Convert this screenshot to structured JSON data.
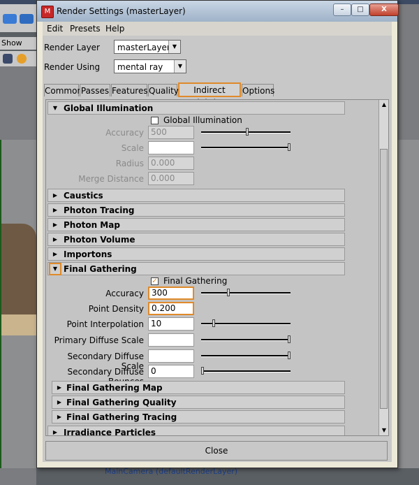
{
  "window": {
    "title": "Render Settings (masterLayer)",
    "controls": {
      "minimize": "–",
      "maximize": "□",
      "close": "X"
    }
  },
  "menu": [
    "Edit",
    "Presets",
    "Help"
  ],
  "render_layer": {
    "label": "Render Layer",
    "value": "masterLayer"
  },
  "render_using": {
    "label": "Render Using",
    "value": "mental ray"
  },
  "tabs": [
    "Common",
    "Passes",
    "Features",
    "Quality",
    "Indirect Lighting",
    "Options"
  ],
  "active_tab": "Indirect Lighting",
  "global_illumination": {
    "header": "Global Illumination",
    "checkbox_label": "Global Illumination",
    "checked": false,
    "fields": [
      {
        "label": "Accuracy",
        "value": "500",
        "slider": 0.52
      },
      {
        "label": "Scale",
        "value": "",
        "slider": 1.0
      },
      {
        "label": "Radius",
        "value": "0.000"
      },
      {
        "label": "Merge Distance",
        "value": "0.000"
      }
    ]
  },
  "collapsed_sections": [
    "Caustics",
    "Photon Tracing",
    "Photon Map",
    "Photon Volume",
    "Importons"
  ],
  "final_gathering": {
    "header": "Final Gathering",
    "checkbox_label": "Final Gathering",
    "checked": true,
    "fields": [
      {
        "label": "Accuracy",
        "value": "300",
        "slider": 0.3
      },
      {
        "label": "Point Density",
        "value": "0.200"
      },
      {
        "label": "Point Interpolation",
        "value": "10",
        "slider": 0.13
      },
      {
        "label": "Primary Diffuse Scale",
        "value": "",
        "slider": 1.0
      },
      {
        "label": "Secondary Diffuse Scale",
        "value": "",
        "slider": 1.0
      },
      {
        "label": "Secondary Diffuse Bounces",
        "value": "0",
        "slider": 0.0
      }
    ],
    "subsections": [
      "Final Gathering Map",
      "Final Gathering Quality",
      "Final Gathering Tracing"
    ]
  },
  "last_section": "Irradiance Particles",
  "close_label": "Close",
  "background": {
    "show_menu": "Show",
    "camera_label": "MainCamera (defaultRenderLayer)"
  },
  "colors": {
    "highlight": "#e08a2a",
    "panel": "#c8c8c8"
  }
}
